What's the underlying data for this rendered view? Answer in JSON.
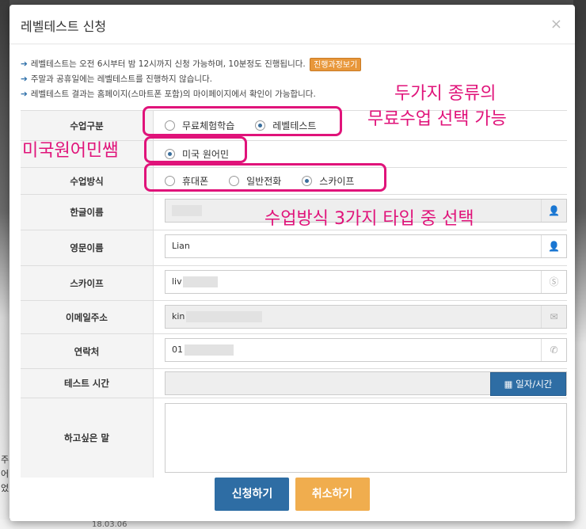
{
  "modal": {
    "title": "레벨테스트 신청",
    "close": "×"
  },
  "notes": [
    "레벨테스트는 오전 6시부터 밤 12시까지 신청 가능하며, 10분정도 진행됩니다.",
    "주말과 공휴일에는 레벨테스트를 진행하지 않습니다.",
    "레벨테스트 결과는 홈페이지(스마트폰 포함)의 마이페이지에서 확인이 가능합니다."
  ],
  "process_button": "진행과정보기",
  "form": {
    "class_type": {
      "label": "수업구분",
      "options": [
        "무료체험학습",
        "레벨테스트"
      ],
      "selected": 1
    },
    "teacher": {
      "options": [
        "미국 원어민"
      ],
      "selected": 0
    },
    "class_method": {
      "label": "수업방식",
      "options": [
        "휴대폰",
        "일반전화",
        "스카이프"
      ],
      "selected": 2
    },
    "korean_name": {
      "label": "한글이름",
      "value": ""
    },
    "english_name": {
      "label": "영문이름",
      "value": "Lian"
    },
    "skype": {
      "label": "스카이프",
      "value": "liv"
    },
    "email": {
      "label": "이메일주소",
      "value": "kin"
    },
    "phone": {
      "label": "연락처",
      "value": "01"
    },
    "test_time": {
      "label": "테스트 시간",
      "button": "일자/시간"
    },
    "message": {
      "label": "하고싶은 말"
    }
  },
  "buttons": {
    "apply": "신청하기",
    "cancel": "취소하기"
  },
  "annotations": {
    "two_types_line1": "두가지 종류의",
    "two_types_line2": "무료수업 선택 가능",
    "native": "미국원어민쌤",
    "three_methods": "수업방식 3가지 타입 중 선택"
  },
  "background_fragments": [
    "주",
    "어",
    "었",
    "18.03.06"
  ],
  "colors": {
    "primary": "#2e6da4",
    "warning": "#f0ad4e",
    "annotation": "#e0137a"
  }
}
